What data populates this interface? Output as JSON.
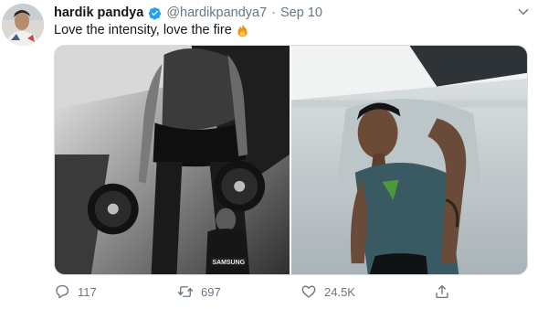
{
  "tweet": {
    "author_name": "hardik pandya",
    "author_handle": "@hardikpandya7",
    "separator": "·",
    "date": "Sep 10",
    "text": "Love the intensity, love the fire",
    "verified": true
  },
  "media": {
    "left_photo": {
      "jersey_text": "SAMSUNG"
    },
    "right_photo": {}
  },
  "actions": {
    "replies": "117",
    "retweets": "697",
    "likes": "24.5K"
  },
  "icons": {
    "verified": "verified-badge-icon",
    "fire": "fire-emoji-icon",
    "caret": "chevron-down-icon",
    "reply": "reply-icon",
    "retweet": "retweet-icon",
    "like": "heart-icon",
    "share": "share-icon"
  },
  "colors": {
    "verified_blue": "#1da1f2",
    "muted_text": "#657786",
    "text": "#14171a"
  }
}
